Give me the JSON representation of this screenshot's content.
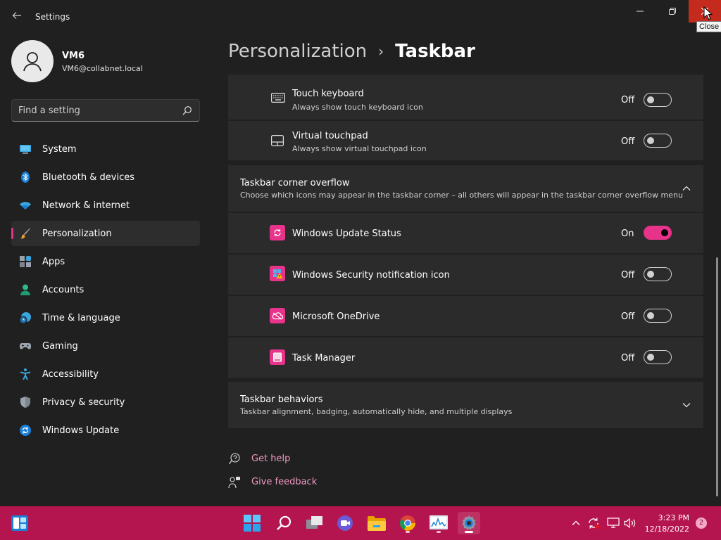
{
  "window": {
    "title": "Settings",
    "tooltip": "Close"
  },
  "profile": {
    "name": "VM6",
    "email": "VM6@collabnet.local"
  },
  "search": {
    "placeholder": "Find a setting"
  },
  "sidebar": {
    "items": [
      {
        "label": "System",
        "icon": "system-icon"
      },
      {
        "label": "Bluetooth & devices",
        "icon": "bluetooth-icon"
      },
      {
        "label": "Network & internet",
        "icon": "wifi-icon"
      },
      {
        "label": "Personalization",
        "icon": "brush-icon",
        "active": true
      },
      {
        "label": "Apps",
        "icon": "apps-icon"
      },
      {
        "label": "Accounts",
        "icon": "accounts-icon"
      },
      {
        "label": "Time & language",
        "icon": "clock-globe-icon"
      },
      {
        "label": "Gaming",
        "icon": "gamepad-icon"
      },
      {
        "label": "Accessibility",
        "icon": "accessibility-icon"
      },
      {
        "label": "Privacy & security",
        "icon": "shield-icon"
      },
      {
        "label": "Windows Update",
        "icon": "update-icon"
      }
    ]
  },
  "header": {
    "parent": "Personalization",
    "separator": "›",
    "current": "Taskbar"
  },
  "pen_menu_rows": [
    {
      "title": "Touch keyboard",
      "subtitle": "Always show touch keyboard icon",
      "state": "Off",
      "on": false
    },
    {
      "title": "Virtual touchpad",
      "subtitle": "Always show virtual touchpad icon",
      "state": "Off",
      "on": false
    }
  ],
  "corner_overflow": {
    "title": "Taskbar corner overflow",
    "subtitle": "Choose which icons may appear in the taskbar corner – all others will appear in the taskbar corner overflow menu",
    "items": [
      {
        "title": "Windows Update Status",
        "state": "On",
        "on": true,
        "icon": "windows-update-status-icon"
      },
      {
        "title": "Windows Security notification icon",
        "state": "Off",
        "on": false,
        "icon": "windows-security-icon"
      },
      {
        "title": "Microsoft OneDrive",
        "state": "Off",
        "on": false,
        "icon": "onedrive-icon"
      },
      {
        "title": "Task Manager",
        "state": "Off",
        "on": false,
        "icon": "task-manager-icon"
      }
    ]
  },
  "behaviors": {
    "title": "Taskbar behaviors",
    "subtitle": "Taskbar alignment, badging, automatically hide, and multiple displays"
  },
  "links": {
    "help": "Get help",
    "feedback": "Give feedback"
  },
  "taskbar": {
    "time": "3:23 PM",
    "date": "12/18/2022",
    "notifications": "2"
  },
  "colors": {
    "accent": "#e8338a",
    "taskbar": "#b5154e",
    "background": "#202020",
    "card": "#2b2b2b",
    "close": "#c42b1c"
  }
}
